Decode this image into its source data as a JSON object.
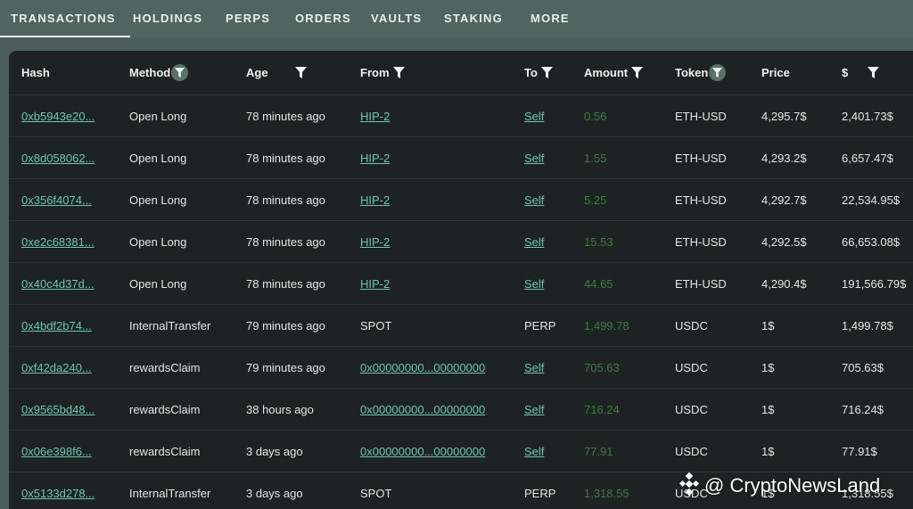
{
  "tabs": [
    {
      "label": "TRANSACTIONS",
      "active": true
    },
    {
      "label": "HOLDINGS",
      "active": false
    },
    {
      "label": "PERPS",
      "active": false
    },
    {
      "label": "ORDERS",
      "active": false
    },
    {
      "label": "VAULTS",
      "active": false
    },
    {
      "label": "STAKING",
      "active": false
    },
    {
      "label": "MORE",
      "active": false
    }
  ],
  "table": {
    "columns": [
      {
        "label": "Hash",
        "filter": "none"
      },
      {
        "label": "Method",
        "filter": "round"
      },
      {
        "label": "Age",
        "filter": "plain"
      },
      {
        "label": "From",
        "filter": "plain"
      },
      {
        "label": "To",
        "filter": "plain"
      },
      {
        "label": "Amount",
        "filter": "plain"
      },
      {
        "label": "Token",
        "filter": "round"
      },
      {
        "label": "Price",
        "filter": "none"
      },
      {
        "label": "$",
        "filter": "plain"
      }
    ],
    "rows": [
      {
        "hash": "0xb5943e20...",
        "method": "Open Long",
        "age": "78 minutes ago",
        "from": "HIP-2",
        "from_link": true,
        "to": "Self",
        "to_link": true,
        "amount": "0.56",
        "token": "ETH-USD",
        "price": "4,295.7$",
        "usd": "2,401.73$"
      },
      {
        "hash": "0x8d058062...",
        "method": "Open Long",
        "age": "78 minutes ago",
        "from": "HIP-2",
        "from_link": true,
        "to": "Self",
        "to_link": true,
        "amount": "1.55",
        "token": "ETH-USD",
        "price": "4,293.2$",
        "usd": "6,657.47$"
      },
      {
        "hash": "0x356f4074...",
        "method": "Open Long",
        "age": "78 minutes ago",
        "from": "HIP-2",
        "from_link": true,
        "to": "Self",
        "to_link": true,
        "amount": "5.25",
        "token": "ETH-USD",
        "price": "4,292.7$",
        "usd": "22,534.95$"
      },
      {
        "hash": "0xe2c68381...",
        "method": "Open Long",
        "age": "78 minutes ago",
        "from": "HIP-2",
        "from_link": true,
        "to": "Self",
        "to_link": true,
        "amount": "15.53",
        "token": "ETH-USD",
        "price": "4,292.5$",
        "usd": "66,653.08$"
      },
      {
        "hash": "0x40c4d37d...",
        "method": "Open Long",
        "age": "78 minutes ago",
        "from": "HIP-2",
        "from_link": true,
        "to": "Self",
        "to_link": true,
        "amount": "44.65",
        "token": "ETH-USD",
        "price": "4,290.4$",
        "usd": "191,566.79$"
      },
      {
        "hash": "0x4bdf2b74...",
        "method": "InternalTransfer",
        "age": "79 minutes ago",
        "from": "SPOT",
        "from_link": false,
        "to": "PERP",
        "to_link": false,
        "amount": "1,499.78",
        "token": "USDC",
        "price": "1$",
        "usd": "1,499.78$"
      },
      {
        "hash": "0xf42da240...",
        "method": "rewardsClaim",
        "age": "79 minutes ago",
        "from": "0x00000000...00000000",
        "from_link": true,
        "to": "Self",
        "to_link": true,
        "amount": "705.63",
        "token": "USDC",
        "price": "1$",
        "usd": "705.63$"
      },
      {
        "hash": "0x9565bd48...",
        "method": "rewardsClaim",
        "age": "38 hours ago",
        "from": "0x00000000...00000000",
        "from_link": true,
        "to": "Self",
        "to_link": true,
        "amount": "716.24",
        "token": "USDC",
        "price": "1$",
        "usd": "716.24$"
      },
      {
        "hash": "0x06e398f6...",
        "method": "rewardsClaim",
        "age": "3 days ago",
        "from": "0x00000000...00000000",
        "from_link": true,
        "to": "Self",
        "to_link": true,
        "amount": "77.91",
        "token": "USDC",
        "price": "1$",
        "usd": "77.91$"
      },
      {
        "hash": "0x5133d278...",
        "method": "InternalTransfer",
        "age": "3 days ago",
        "from": "SPOT",
        "from_link": false,
        "to": "PERP",
        "to_link": false,
        "amount": "1,318.55",
        "token": "USDC",
        "price": "1$",
        "usd": "1,318.55$"
      }
    ]
  },
  "watermark": {
    "text": "@ CryptoNewsLand"
  },
  "colors": {
    "link": "#6fc4b4",
    "amount": "#3f7a45",
    "panel": "#1d2322",
    "tabbar": "#50655f"
  }
}
